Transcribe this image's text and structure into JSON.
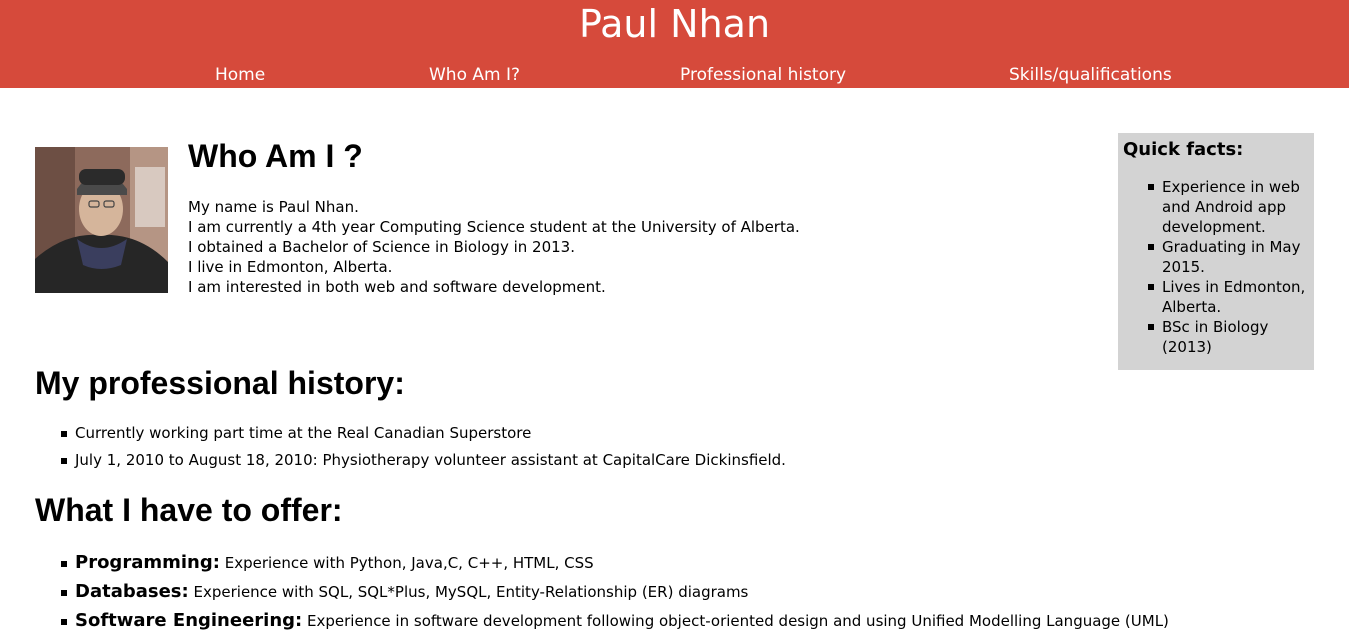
{
  "header": {
    "title": "Paul Nhan",
    "nav": [
      "Home",
      "Who Am I?",
      "Professional history",
      "Skills/qualifications"
    ]
  },
  "about": {
    "heading": "Who Am I ?",
    "lines": [
      "My name is Paul Nhan.",
      "I am currently a 4th year Computing Science student at the University of Alberta.",
      "I obtained a Bachelor of Science in Biology in 2013.",
      "I live in Edmonton, Alberta.",
      "I am interested in both web and software development."
    ]
  },
  "quick_facts": {
    "title": "Quick facts:",
    "items": [
      "Experience in web and Android app development.",
      "Graduating in May 2015.",
      "Lives in Edmonton, Alberta.",
      "BSc in Biology (2013)"
    ]
  },
  "history": {
    "heading": "My professional history:",
    "items": [
      "Currently working part time at the Real Canadian Superstore",
      "July 1, 2010 to August 18, 2010: Physiotherapy volunteer assistant at CapitalCare Dickinsfield."
    ]
  },
  "offer": {
    "heading": "What I have to offer:",
    "items": [
      {
        "term": "Programming:",
        "text": "Experience with Python, Java,C, C++, HTML, CSS"
      },
      {
        "term": "Databases:",
        "text": "Experience with SQL, SQL*Plus, MySQL, Entity-Relationship (ER) diagrams"
      },
      {
        "term": "Software Engineering:",
        "text": "Experience in software development following object-oriented design and using Unified Modelling Language (UML)"
      }
    ]
  },
  "colors": {
    "header_bg": "#d64a3b",
    "facts_bg": "#d3d3d3"
  }
}
